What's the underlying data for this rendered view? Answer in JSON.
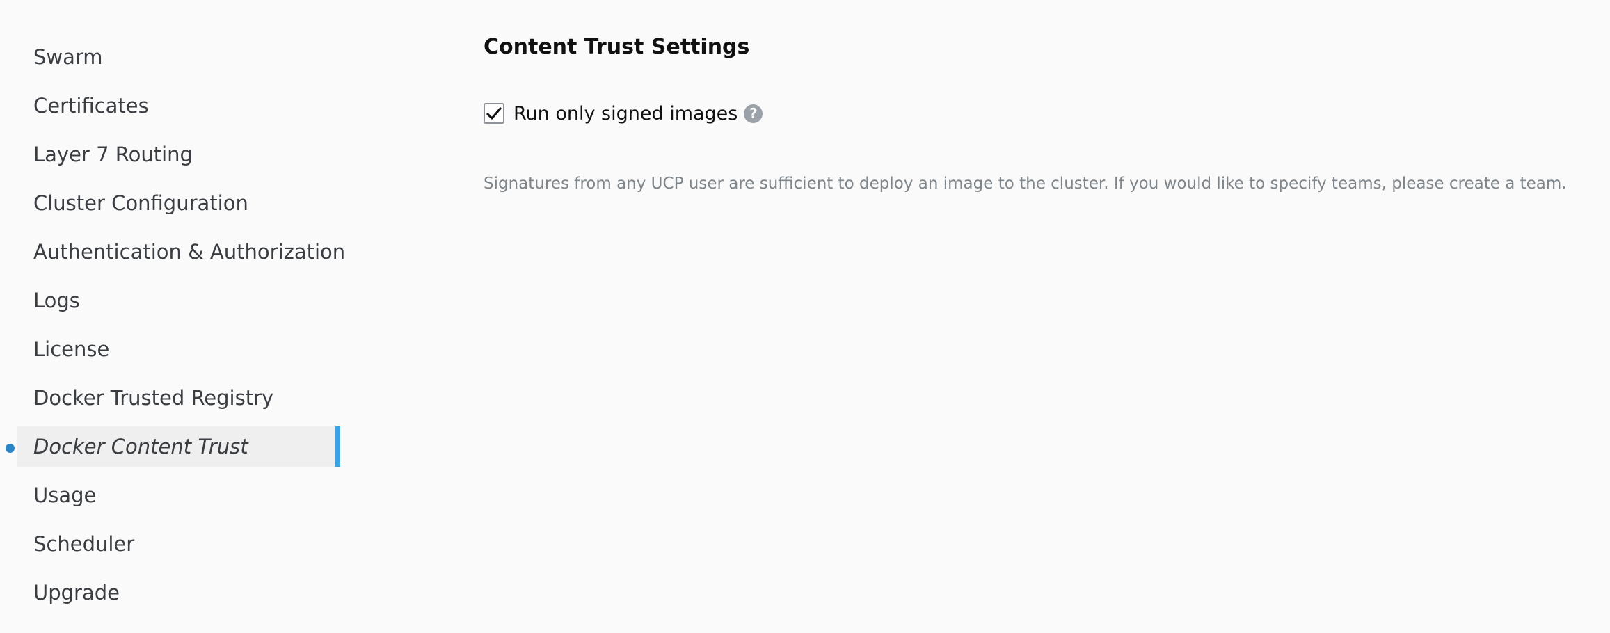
{
  "sidebar": {
    "items": [
      {
        "label": "Swarm"
      },
      {
        "label": "Certificates"
      },
      {
        "label": "Layer 7 Routing"
      },
      {
        "label": "Cluster Configuration"
      },
      {
        "label": "Authentication & Authorization"
      },
      {
        "label": "Logs"
      },
      {
        "label": "License"
      },
      {
        "label": "Docker Trusted Registry"
      },
      {
        "label": "Docker Content Trust",
        "active": true
      },
      {
        "label": "Usage"
      },
      {
        "label": "Scheduler"
      },
      {
        "label": "Upgrade"
      }
    ]
  },
  "content_trust": {
    "title": "Content Trust Settings",
    "checkbox_label": "Run only signed images",
    "checkbox_checked": true,
    "help_icon": "question-circle-icon",
    "help_glyph": "?",
    "help_text": "Signatures from any UCP user are sufficient to deploy an image to the cluster. If you would like to specify teams, please create a team."
  },
  "colors": {
    "accent": "#3ba1e0",
    "active_dot": "#2a85c8",
    "active_bg": "#efefef",
    "help_icon_bg": "#9aa1a8",
    "muted_text": "#7e868c"
  }
}
